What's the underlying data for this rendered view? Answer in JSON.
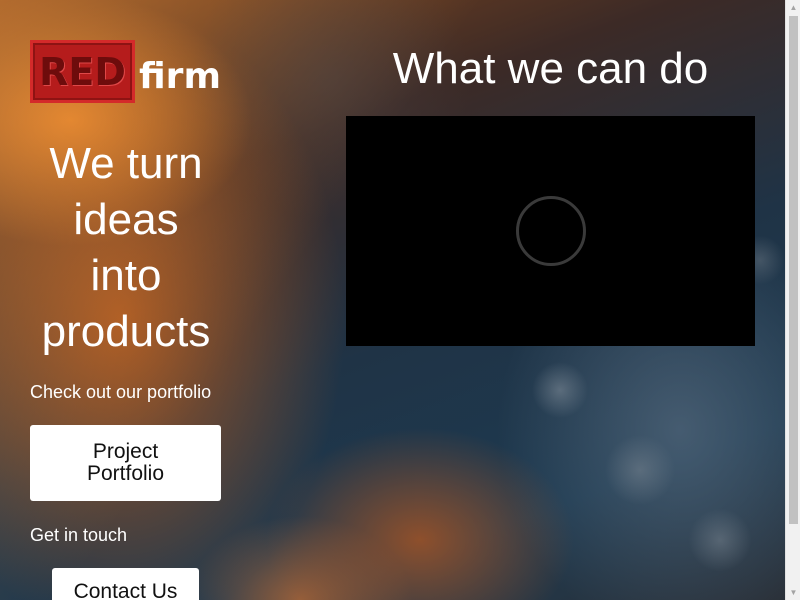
{
  "brand": {
    "logo_red": "RED",
    "logo_firm": "firm"
  },
  "hero": {
    "headline_lines": [
      "We turn",
      "ideas",
      "into",
      "products"
    ]
  },
  "portfolio": {
    "label": "Check out our portfolio",
    "button_label_lines": [
      "Project",
      "Portfolio"
    ]
  },
  "contact": {
    "label": "Get in touch",
    "button_label": "Contact Us"
  },
  "services": {
    "title": "What we can do"
  },
  "video": {
    "state": "loading",
    "icon": "loading-spinner-icon"
  },
  "scrollbar": {
    "up_icon": "chevron-up-icon",
    "down_icon": "chevron-down-icon"
  },
  "colors": {
    "brand_red": "#b51c1c",
    "button_bg": "#ffffff",
    "video_bg": "#000000"
  }
}
